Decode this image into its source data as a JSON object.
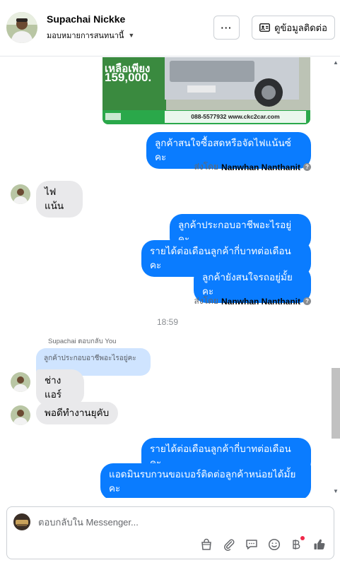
{
  "header": {
    "contact_name": "Supachai Nickke",
    "assign_label": "มอบหมายการสนทนานี้",
    "more_label": "···",
    "contact_info_label": "ดูข้อมูลติดต่อ"
  },
  "car_ad": {
    "price_line1": "เหลือเพียง",
    "price_line2": "159,000.",
    "footer": "088-5577932  www.ckc2car.com"
  },
  "messages": {
    "m1": "ลูกค้าสนใจซื้อสดหรือจัดไฟแน้นซ์คะ",
    "sent_by_1_prefix": "ส่งโดย",
    "sent_by_1_name": "Nanwhan Nanthanit",
    "m2": "ไฟแน้น",
    "m3": "ลูกค้าประกอบอาชีพอะไรอยู่คะ",
    "m4": "รายได้ต่อเดือนลูกค้ากี่บาทต่อเดือนคะ",
    "m5": "ลูกค้ายังสนใจรถอยู่มั้ยคะ",
    "sent_by_2_prefix": "ส่งโดย",
    "sent_by_2_name": "Nanwhan Nanthanit",
    "time": "18:59",
    "reply_label": "Supachai ตอบกลับ You",
    "quoted": "ลูกค้าประกอบอาชีพอะไรอยู่คะ",
    "m6": "ช่างแอร์",
    "m7": "พอดีทำงานยุคับ",
    "m8": "รายได้ต่อเดือนลูกค้ากี่บาทต่อเดือนคะ",
    "m9_line1": "แอดมินรบกวนขอเบอร์ติดต่อลูกค้าหน่อยได้มั้ย",
    "m9_line2": "คะ"
  },
  "composer": {
    "placeholder": "ตอบกลับใน Messenger..."
  },
  "icons": {
    "more": "more-icon",
    "contact": "contact-card-icon",
    "tools": [
      "shop-bag-icon",
      "attachment-icon",
      "saved-reply-icon",
      "emoji-icon",
      "baht-payment-icon",
      "like-icon"
    ]
  },
  "colors": {
    "outgoing": "#0a7cff",
    "incoming": "#e9e9eb",
    "quote": "#cfe4ff",
    "notification": "#f02849"
  }
}
